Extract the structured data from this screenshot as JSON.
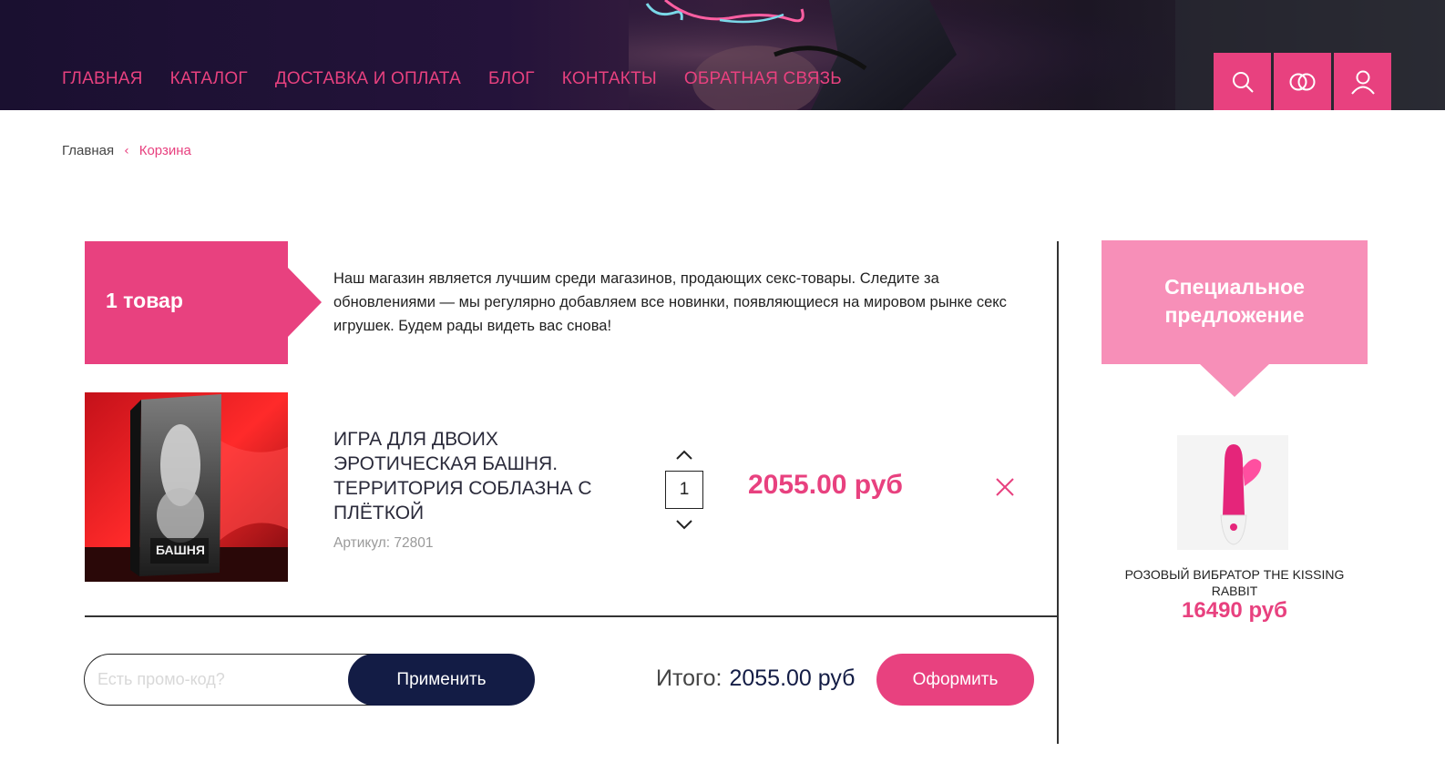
{
  "nav": {
    "items": [
      {
        "label": "ГЛАВНАЯ"
      },
      {
        "label": "КАТАЛОГ"
      },
      {
        "label": "ДОСТАВКА И ОПЛАТА"
      },
      {
        "label": "БЛОГ"
      },
      {
        "label": "КОНТАКТЫ"
      },
      {
        "label": "ОБРАТНАЯ СВЯЗЬ"
      }
    ]
  },
  "header_icons": [
    "search-icon",
    "compare-icon",
    "user-icon"
  ],
  "breadcrumb": {
    "home": "Главная",
    "separator": "‹",
    "current": "Корзина"
  },
  "cart": {
    "count_label": "1 товар",
    "intro": "Наш магазин является лучшим среди магазинов, продающих секс-товары. Следите за обновлениями — мы регулярно добавляем все новинки, появляющиеся на мировом рынке секс игрушек. Будем рады видеть вас снова!",
    "items": [
      {
        "title": "ИГРА ДЛЯ ДВОИХ ЭРОТИЧЕСКАЯ БАШНЯ. ТЕРРИТОРИЯ СОБЛАЗНА С ПЛЁТКОЙ",
        "sku": "Артикул: 72801",
        "quantity": "1",
        "price": "2055.00 руб"
      }
    ]
  },
  "promo": {
    "placeholder": "Есть промо-код?",
    "apply_label": "Применить"
  },
  "totals": {
    "label": "Итого:",
    "value": "2055.00 руб",
    "checkout_label": "Оформить"
  },
  "special_offer": {
    "title_line1": "Специальное",
    "title_line2": "предложение",
    "product_name": "РОЗОВЫЙ ВИБРАТОР THE KISSING RABBIT",
    "price": "16490 руб"
  },
  "colors": {
    "accent": "#e8417f",
    "accent_light": "#f78fb8",
    "navy": "#131c45",
    "header_bg": "#1a1030"
  }
}
